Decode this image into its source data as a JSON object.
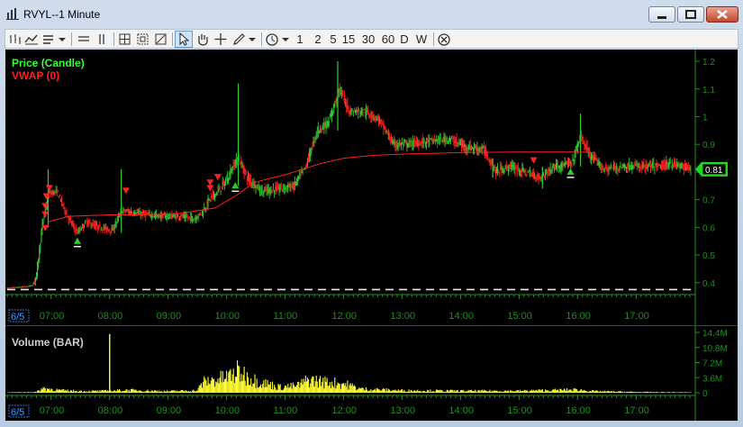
{
  "window": {
    "title": "RVYL--1 Minute"
  },
  "toolbar": {
    "timeframes": [
      "1",
      "2",
      "5",
      "15",
      "30",
      "60",
      "D",
      "W"
    ]
  },
  "colors": {
    "background": "#000000",
    "up_candle": "#33cc33",
    "down_candle": "#ff2020",
    "vwap": "#ff2020",
    "volume": "#ffff33",
    "price_axis": "#1f8f1f",
    "price_label_bg": "#1fd81f"
  },
  "chart_data": [
    {
      "type": "candlestick",
      "legend": [
        {
          "label": "Price (Candle)",
          "color": "#33ff33"
        },
        {
          "label": "VWAP (0)",
          "color": "#ff2020"
        }
      ],
      "ylim": [
        0.37,
        1.21
      ],
      "y_ticks": [
        0.4,
        0.5,
        0.6,
        0.7,
        0.8,
        0.9,
        1.0,
        1.1,
        1.2
      ],
      "y_tick_labels": [
        "0.4",
        "0.5",
        "0.6",
        "0.7",
        "0.8",
        "0.9",
        "1",
        "1.1",
        "1.2"
      ],
      "last_price_label": "0.81",
      "date_marker": "6/5",
      "x_tick_labels": [
        "07:00",
        "08:00",
        "09:00",
        "10:00",
        "11:00",
        "12:00",
        "13:00",
        "14:00",
        "15:00",
        "16:00",
        "17:00"
      ],
      "x_tick_times": [
        7,
        8,
        9,
        10,
        11,
        12,
        13,
        14,
        15,
        16,
        17
      ],
      "time_range": [
        6.25,
        17.95
      ],
      "price_path": [
        [
          6.25,
          0.38
        ],
        [
          6.55,
          0.385
        ],
        [
          6.68,
          0.39
        ],
        [
          6.75,
          0.43
        ],
        [
          6.85,
          0.61
        ],
        [
          6.95,
          0.72
        ],
        [
          7.1,
          0.73
        ],
        [
          7.3,
          0.63
        ],
        [
          7.45,
          0.58
        ],
        [
          7.6,
          0.62
        ],
        [
          7.8,
          0.6
        ],
        [
          8.05,
          0.59
        ],
        [
          8.2,
          0.66
        ],
        [
          8.5,
          0.65
        ],
        [
          8.9,
          0.64
        ],
        [
          9.2,
          0.64
        ],
        [
          9.45,
          0.63
        ],
        [
          9.6,
          0.66
        ],
        [
          9.7,
          0.7
        ],
        [
          9.85,
          0.73
        ],
        [
          10.0,
          0.77
        ],
        [
          10.13,
          0.83
        ],
        [
          10.2,
          0.85
        ],
        [
          10.35,
          0.78
        ],
        [
          10.6,
          0.73
        ],
        [
          10.9,
          0.74
        ],
        [
          11.15,
          0.75
        ],
        [
          11.35,
          0.82
        ],
        [
          11.55,
          0.95
        ],
        [
          11.75,
          0.98
        ],
        [
          11.92,
          1.1
        ],
        [
          12.1,
          1.02
        ],
        [
          12.35,
          1.02
        ],
        [
          12.6,
          0.99
        ],
        [
          12.85,
          0.9
        ],
        [
          13.1,
          0.9
        ],
        [
          13.4,
          0.91
        ],
        [
          13.8,
          0.92
        ],
        [
          14.1,
          0.89
        ],
        [
          14.4,
          0.88
        ],
        [
          14.6,
          0.8
        ],
        [
          14.85,
          0.82
        ],
        [
          15.1,
          0.8
        ],
        [
          15.35,
          0.78
        ],
        [
          15.6,
          0.82
        ],
        [
          15.9,
          0.83
        ],
        [
          16.05,
          0.93
        ],
        [
          16.2,
          0.86
        ],
        [
          16.45,
          0.81
        ],
        [
          16.8,
          0.82
        ],
        [
          17.1,
          0.82
        ],
        [
          17.4,
          0.82
        ],
        [
          17.6,
          0.83
        ],
        [
          17.95,
          0.81
        ]
      ],
      "vwap_path": [
        [
          6.95,
          0.62
        ],
        [
          7.3,
          0.64
        ],
        [
          8.0,
          0.645
        ],
        [
          8.6,
          0.645
        ],
        [
          9.2,
          0.65
        ],
        [
          9.8,
          0.67
        ],
        [
          10.2,
          0.72
        ],
        [
          10.45,
          0.76
        ],
        [
          10.7,
          0.775
        ],
        [
          11.0,
          0.79
        ],
        [
          11.3,
          0.81
        ],
        [
          11.6,
          0.83
        ],
        [
          12.0,
          0.85
        ],
        [
          12.5,
          0.86
        ],
        [
          13.0,
          0.865
        ],
        [
          14.0,
          0.87
        ],
        [
          15.0,
          0.872
        ],
        [
          16.0,
          0.872
        ],
        [
          16.3,
          0.87
        ]
      ],
      "signals": [
        {
          "t": 6.9,
          "p": 0.595,
          "dir": "down"
        },
        {
          "t": 6.9,
          "p": 0.645,
          "dir": "down"
        },
        {
          "t": 6.9,
          "p": 0.675,
          "dir": "down"
        },
        {
          "t": 6.92,
          "p": 0.71,
          "dir": "down"
        },
        {
          "t": 6.97,
          "p": 0.74,
          "dir": "down"
        },
        {
          "t": 7.45,
          "p": 0.55,
          "dir": "up"
        },
        {
          "t": 8.28,
          "p": 0.73,
          "dir": "down"
        },
        {
          "t": 9.72,
          "p": 0.74,
          "dir": "down"
        },
        {
          "t": 9.72,
          "p": 0.76,
          "dir": "down"
        },
        {
          "t": 9.85,
          "p": 0.78,
          "dir": "down"
        },
        {
          "t": 10.15,
          "p": 0.75,
          "dir": "up"
        },
        {
          "t": 15.25,
          "p": 0.84,
          "dir": "down"
        },
        {
          "t": 15.88,
          "p": 0.8,
          "dir": "up"
        }
      ]
    },
    {
      "type": "bar",
      "legend": [
        {
          "label": "Volume (BAR)",
          "color": "#d8d8d8"
        }
      ],
      "ylim": [
        0,
        14.4
      ],
      "y_unit": "M",
      "y_ticks": [
        0,
        3.6,
        7.2,
        10.8,
        14.4
      ],
      "y_tick_labels": [
        "0",
        "3.6M",
        "7.2M",
        "10.8M",
        "14.4M"
      ],
      "date_marker": "6/5",
      "x_tick_labels": [
        "07:00",
        "08:00",
        "09:00",
        "10:00",
        "11:00",
        "12:00",
        "13:00",
        "14:00",
        "15:00",
        "16:00",
        "17:00"
      ],
      "spike": {
        "t": 8.0,
        "value": 14.0
      },
      "volume_profile": [
        [
          6.25,
          0.1
        ],
        [
          6.75,
          0.2
        ],
        [
          6.85,
          1.2
        ],
        [
          7.2,
          0.6
        ],
        [
          7.6,
          0.4
        ],
        [
          8.0,
          0.5
        ],
        [
          8.3,
          0.7
        ],
        [
          9.0,
          0.4
        ],
        [
          9.5,
          0.6
        ],
        [
          9.6,
          2.8
        ],
        [
          10.0,
          4.0
        ],
        [
          10.2,
          5.5
        ],
        [
          10.5,
          3.2
        ],
        [
          10.9,
          1.5
        ],
        [
          11.2,
          1.8
        ],
        [
          11.4,
          3.4
        ],
        [
          11.7,
          2.8
        ],
        [
          12.0,
          2.4
        ],
        [
          12.3,
          1.0
        ],
        [
          13.0,
          0.6
        ],
        [
          14.0,
          0.5
        ],
        [
          15.0,
          0.5
        ],
        [
          16.0,
          0.8
        ],
        [
          16.3,
          0.4
        ],
        [
          17.0,
          0.2
        ],
        [
          17.95,
          0.1
        ]
      ]
    }
  ]
}
